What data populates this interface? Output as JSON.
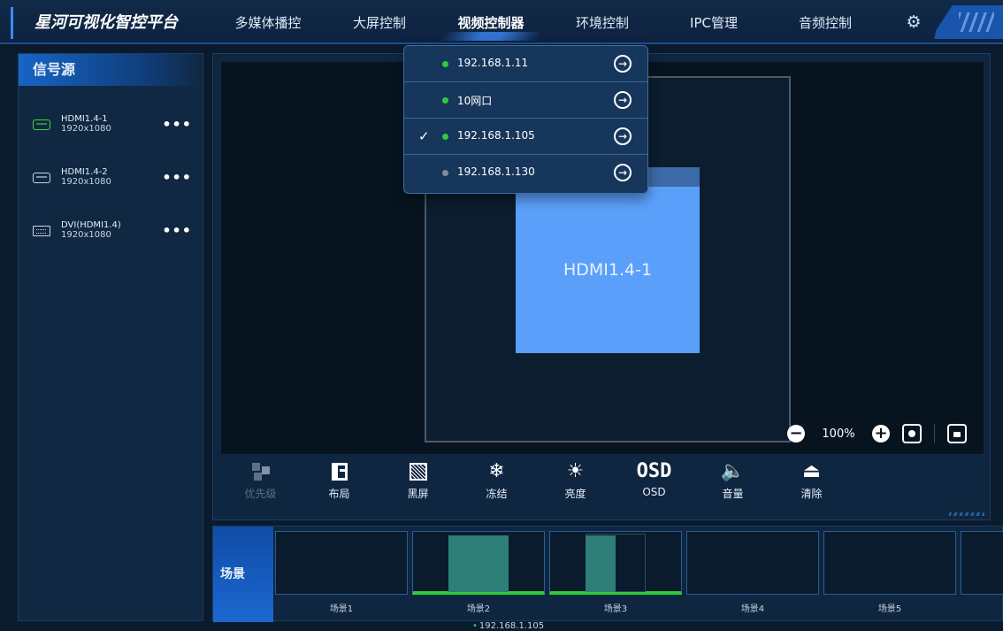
{
  "app": {
    "title": "星河可视化智控平台"
  },
  "nav": {
    "items": [
      {
        "label": "多媒体播控",
        "active": false
      },
      {
        "label": "大屏控制",
        "active": false
      },
      {
        "label": "视频控制器",
        "active": true
      },
      {
        "label": "环境控制",
        "active": false
      },
      {
        "label": "IPC管理",
        "active": false
      },
      {
        "label": "音频控制",
        "active": false
      }
    ],
    "settings_icon": "gear-icon"
  },
  "sources": {
    "header": "信号源",
    "items": [
      {
        "name": "HDMI1.4-1",
        "resolution": "1920x1080",
        "icon": "hdmi-icon",
        "active": true
      },
      {
        "name": "HDMI1.4-2",
        "resolution": "1920x1080",
        "icon": "hdmi-icon",
        "active": false
      },
      {
        "name": "DVI(HDMI1.4)",
        "resolution": "1920x1080",
        "icon": "dvi-icon",
        "active": false
      }
    ],
    "more_label": "•••"
  },
  "canvas": {
    "window_label": "HDMI1.4-1",
    "zoom": "100%"
  },
  "toolbar": [
    {
      "label": "优先级",
      "icon": "priority-icon",
      "enabled": false
    },
    {
      "label": "布局",
      "icon": "layout-icon",
      "enabled": true
    },
    {
      "label": "黑屏",
      "icon": "black-screen-icon",
      "enabled": true
    },
    {
      "label": "冻结",
      "icon": "snowflake-icon",
      "glyph": "❄",
      "enabled": true
    },
    {
      "label": "亮度",
      "icon": "brightness-icon",
      "glyph": "☀",
      "enabled": true
    },
    {
      "label": "OSD",
      "icon": "osd-icon",
      "glyph": "OSD",
      "enabled": true
    },
    {
      "label": "音量",
      "icon": "volume-icon",
      "glyph": "🔈",
      "enabled": true
    },
    {
      "label": "清除",
      "icon": "clear-icon",
      "glyph": "⏏",
      "enabled": true
    }
  ],
  "scenes": {
    "label": "场景",
    "items": [
      {
        "name": "场景1",
        "active": false
      },
      {
        "name": "场景2",
        "active": true
      },
      {
        "name": "场景3",
        "active": true
      },
      {
        "name": "场景4",
        "active": false
      },
      {
        "name": "场景5",
        "active": false
      }
    ]
  },
  "status": {
    "ip": "192.168.1.105"
  },
  "device_dropdown": {
    "items": [
      {
        "label": "192.168.1.11",
        "online": true,
        "selected": false
      },
      {
        "label": "10网口",
        "online": true,
        "selected": false
      },
      {
        "label": "192.168.1.105",
        "online": true,
        "selected": true
      },
      {
        "label": "192.168.1.130",
        "online": false,
        "selected": false
      }
    ]
  },
  "colors": {
    "accent": "#3f8cff",
    "window": "#5aa0fa",
    "online": "#2fcc3a",
    "offline": "#7d8d9c"
  }
}
